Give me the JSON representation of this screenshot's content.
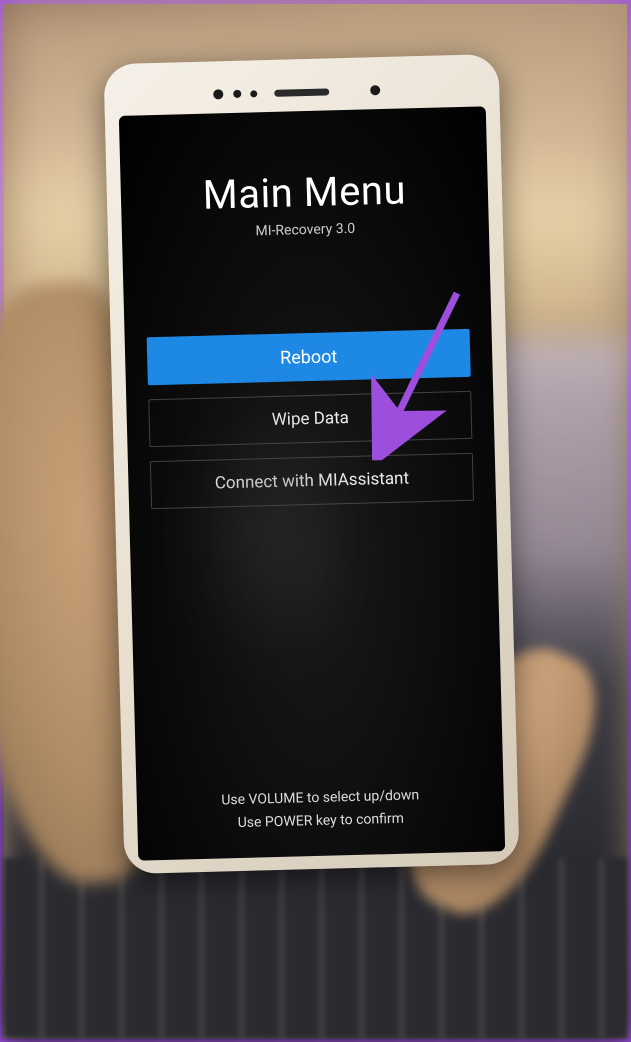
{
  "recovery": {
    "title": "Main Menu",
    "subtitle": "MI-Recovery 3.0",
    "menu": [
      {
        "label": "Reboot",
        "selected": true
      },
      {
        "label": "Wipe Data",
        "selected": false
      },
      {
        "label": "Connect with MIAssistant",
        "selected": false
      }
    ],
    "help_line_1": "Use VOLUME to select up/down",
    "help_line_2": "Use POWER key to confirm"
  },
  "annotation": {
    "arrow_color": "#9d4edd"
  }
}
